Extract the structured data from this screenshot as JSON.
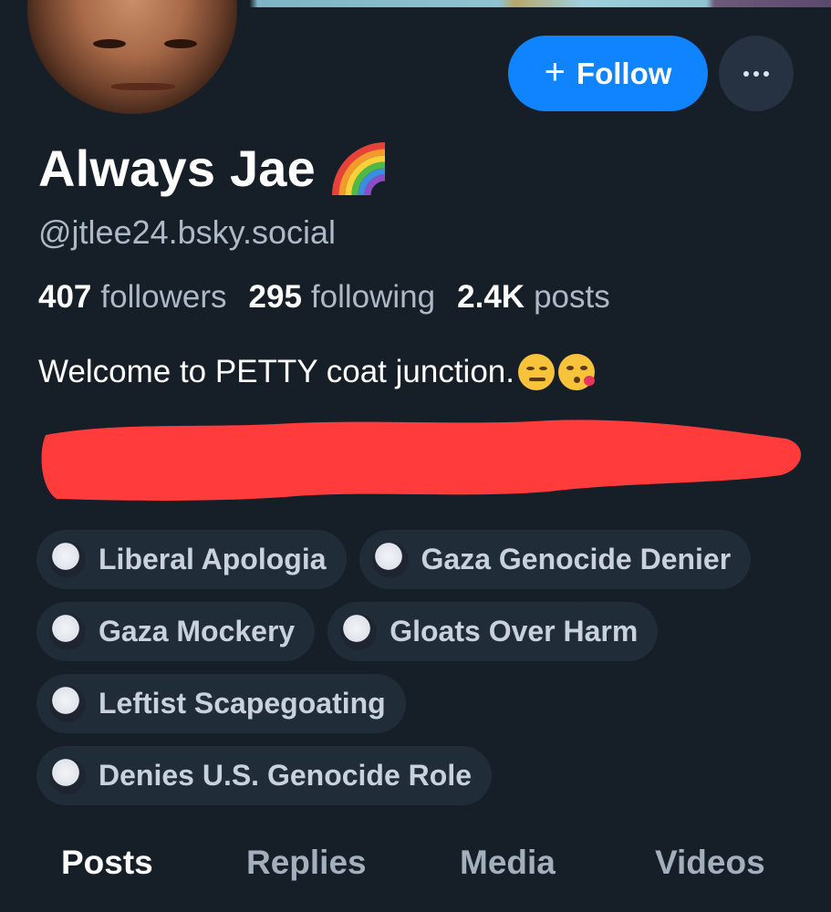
{
  "profile": {
    "display_name": "Always Jae",
    "name_emoji": "rainbow-emoji",
    "handle": "@jtlee24.bsky.social",
    "bio_text": "Welcome to PETTY coat junction.",
    "bio_emojis": [
      "smirking-face-emoji",
      "face-blowing-kiss-emoji"
    ]
  },
  "actions": {
    "follow_label": "Follow",
    "follow_icon": "plus-icon",
    "more_icon": "more-options-icon"
  },
  "stats": {
    "followers_count": "407",
    "followers_label": "followers",
    "following_count": "295",
    "following_label": "following",
    "posts_count": "2.4K",
    "posts_label": "posts"
  },
  "labels": [
    "Liberal Apologia",
    "Gaza Genocide Denier",
    "Gaza Mockery",
    "Gloats Over Harm",
    "Leftist Scapegoating",
    "Denies U.S. Genocide Role"
  ],
  "tabs": [
    "Posts",
    "Replies",
    "Media",
    "Videos"
  ],
  "active_tab": "Posts",
  "colors": {
    "background": "#161e27",
    "follow_button": "#1083fe",
    "label_chip": "#212c39",
    "redaction": "#ff3b3b"
  }
}
